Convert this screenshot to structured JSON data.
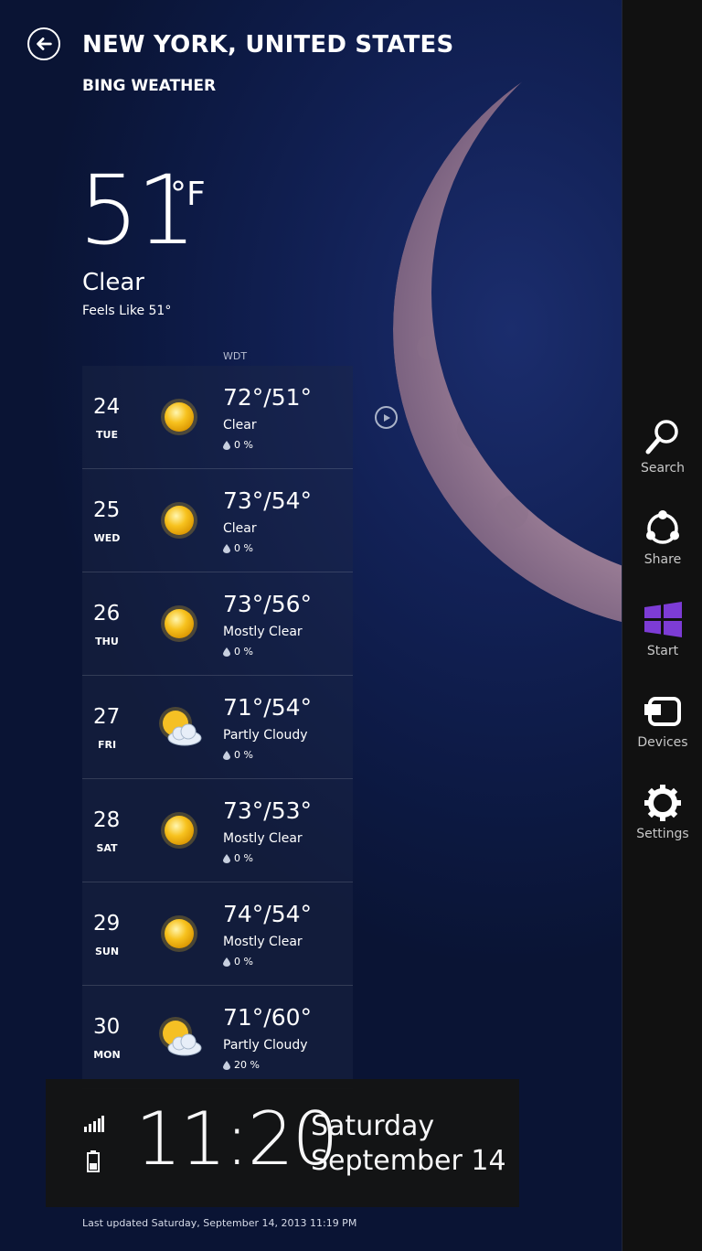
{
  "header": {
    "city": "NEW YORK, UNITED STATES",
    "app_name": "BING WEATHER"
  },
  "current": {
    "temperature": "51",
    "unit": "°F",
    "condition": "Clear",
    "feels_like": "Feels Like 51°"
  },
  "forecast_header": "WDT",
  "forecast": [
    {
      "date": "24",
      "day": "TUE",
      "hilo": "72°/51°",
      "condition": "Clear",
      "precip": "0 %",
      "icon": "sun-icon"
    },
    {
      "date": "25",
      "day": "WED",
      "hilo": "73°/54°",
      "condition": "Clear",
      "precip": "0 %",
      "icon": "sun-icon"
    },
    {
      "date": "26",
      "day": "THU",
      "hilo": "73°/56°",
      "condition": "Mostly Clear",
      "precip": "0 %",
      "icon": "sun-icon"
    },
    {
      "date": "27",
      "day": "FRI",
      "hilo": "71°/54°",
      "condition": "Partly Cloudy",
      "precip": "0 %",
      "icon": "partly-cloudy-icon"
    },
    {
      "date": "28",
      "day": "SAT",
      "hilo": "73°/53°",
      "condition": "Mostly Clear",
      "precip": "0 %",
      "icon": "sun-icon"
    },
    {
      "date": "29",
      "day": "SUN",
      "hilo": "74°/54°",
      "condition": "Mostly Clear",
      "precip": "0 %",
      "icon": "sun-icon"
    },
    {
      "date": "30",
      "day": "MON",
      "hilo": "71°/60°",
      "condition": "Partly Cloudy",
      "precip": "20 %",
      "icon": "partly-cloudy-icon"
    }
  ],
  "clock": {
    "time": "11:20",
    "weekday": "Saturday",
    "date": "September 14"
  },
  "last_updated": "Last updated Saturday, September 14, 2013 11:19 PM",
  "charms": [
    {
      "label": "Search",
      "icon": "search-icon"
    },
    {
      "label": "Share",
      "icon": "share-icon"
    },
    {
      "label": "Start",
      "icon": "windows-logo-icon"
    },
    {
      "label": "Devices",
      "icon": "devices-icon"
    },
    {
      "label": "Settings",
      "icon": "gear-icon"
    }
  ],
  "colors": {
    "background": "#0d1a45",
    "charms_bg": "#111111",
    "start_purple": "#7d3cd6",
    "sun_yellow": "#f7c21e"
  }
}
